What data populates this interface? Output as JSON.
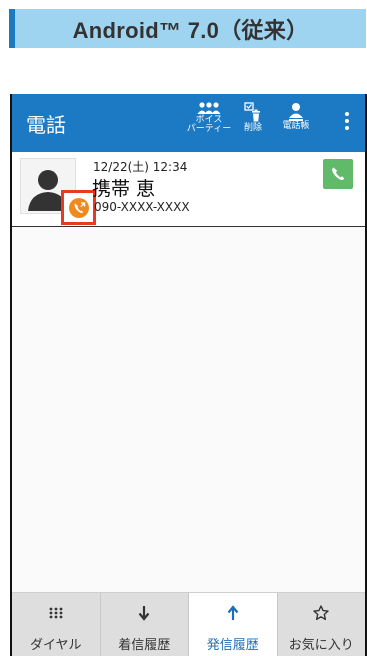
{
  "banner": {
    "title": "Android™ 7.0（従来）"
  },
  "appbar": {
    "title": "電話",
    "actions": [
      {
        "icon": "voice-party-icon",
        "label_line1": "ボイス",
        "label_line2": "パーティー"
      },
      {
        "icon": "delete-icon",
        "label": "削除"
      },
      {
        "icon": "contacts-icon",
        "label": "電話帳"
      },
      {
        "icon": "more-options-icon"
      }
    ]
  },
  "call_log": [
    {
      "datetime": "12/22(土) 12:34",
      "name": "携帯 恵",
      "number": "090-XXXX-XXXX",
      "type_icon": "outgoing-call-icon"
    }
  ],
  "tabs": [
    {
      "label": "ダイヤル",
      "icon": "dialpad-icon",
      "active": false
    },
    {
      "label": "着信履歴",
      "icon": "incoming-arrow-icon",
      "active": false
    },
    {
      "label": "発信履歴",
      "icon": "outgoing-arrow-icon",
      "active": true
    },
    {
      "label": "お気に入り",
      "icon": "star-icon",
      "active": false
    }
  ],
  "colors": {
    "appbar": "#1c79c4",
    "banner": "#9fd4f1",
    "call_button": "#61b96a",
    "highlight": "#e63a24",
    "outgoing_badge": "#f08a1e",
    "active_tab_text": "#1b6fb9"
  }
}
